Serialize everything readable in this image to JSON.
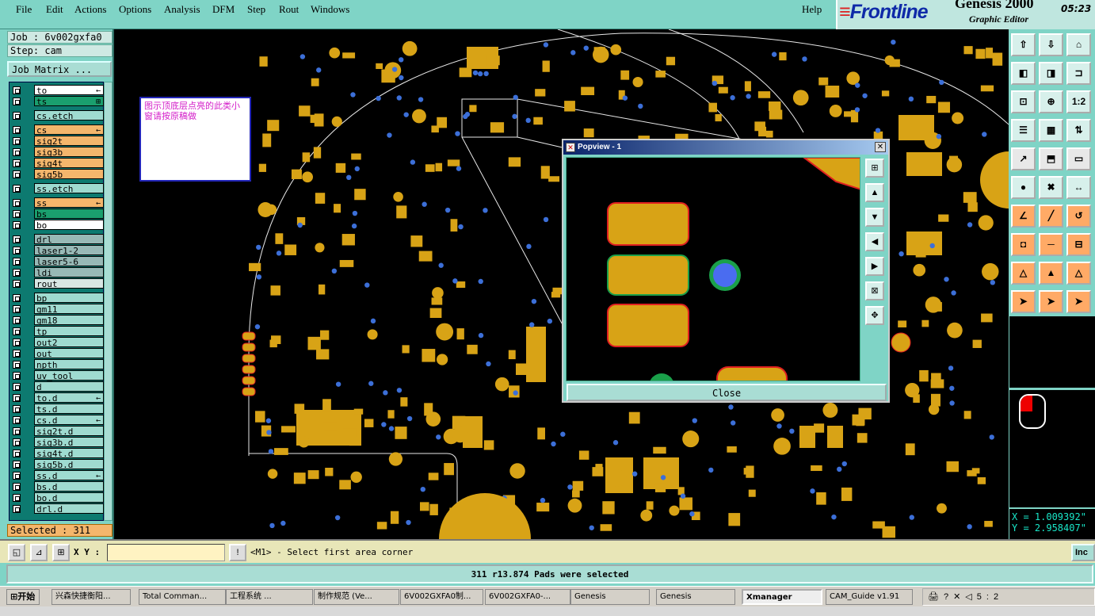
{
  "menubar": {
    "items": [
      "File",
      "Edit",
      "Actions",
      "Options",
      "Analysis",
      "DFM",
      "Step",
      "Rout",
      "Windows"
    ],
    "help": "Help"
  },
  "brand": {
    "logo": "Frontline",
    "product": "Genesis 2000",
    "subtitle": "Graphic Editor",
    "clock": "05:23"
  },
  "left_panel": {
    "job": "Job : 6v002gxfa0",
    "step": "Step: cam",
    "job_matrix": "Job Matrix ...",
    "selected": "Selected : 311",
    "layers": [
      {
        "name": "to",
        "color": "white",
        "mark": "←"
      },
      {
        "name": "ts",
        "color": "green",
        "mark": "⊞"
      },
      {
        "name": "cs.etch",
        "color": "teal"
      },
      {
        "name": "cs",
        "color": "orange",
        "mark": "←"
      },
      {
        "name": "sig2t",
        "color": "orange"
      },
      {
        "name": "sig3b",
        "color": "orange"
      },
      {
        "name": "sig4t",
        "color": "orange"
      },
      {
        "name": "sig5b",
        "color": "orange"
      },
      {
        "name": "ss.etch",
        "color": "teal"
      },
      {
        "name": "ss",
        "color": "orange",
        "mark": "←"
      },
      {
        "name": "bs",
        "color": "green"
      },
      {
        "name": "bo",
        "color": "white"
      },
      {
        "name": "drl",
        "color": "grey"
      },
      {
        "name": "laser1-2",
        "color": "grey"
      },
      {
        "name": "laser5-6",
        "color": "grey"
      },
      {
        "name": "ldi",
        "color": "grey"
      },
      {
        "name": "rout",
        "color": "light"
      },
      {
        "name": "bp",
        "color": "teal"
      },
      {
        "name": "gm11",
        "color": "teal"
      },
      {
        "name": "gm18",
        "color": "teal"
      },
      {
        "name": "tp",
        "color": "teal"
      },
      {
        "name": "out2",
        "color": "teal"
      },
      {
        "name": "out",
        "color": "teal"
      },
      {
        "name": "npth",
        "color": "teal"
      },
      {
        "name": "uv_tool",
        "color": "teal"
      },
      {
        "name": "d",
        "color": "teal"
      },
      {
        "name": "to.d",
        "color": "teal",
        "mark": "←"
      },
      {
        "name": "ts.d",
        "color": "teal"
      },
      {
        "name": "cs.d",
        "color": "teal",
        "mark": "←"
      },
      {
        "name": "sig2t.d",
        "color": "teal"
      },
      {
        "name": "sig3b.d",
        "color": "teal"
      },
      {
        "name": "sig4t.d",
        "color": "teal"
      },
      {
        "name": "sig5b.d",
        "color": "teal"
      },
      {
        "name": "ss.d",
        "color": "teal",
        "mark": "←"
      },
      {
        "name": "bs.d",
        "color": "teal"
      },
      {
        "name": "bo.d",
        "color": "teal"
      },
      {
        "name": "drl.d",
        "color": "teal"
      }
    ]
  },
  "canvas": {
    "note": "图示顶底层点亮的此类小窗请按原稿做",
    "colors": {
      "pad": "#d8a316",
      "via": "#3c6fd8",
      "outline": "#e8e8e8",
      "pad_edge": "#e02020"
    }
  },
  "popview": {
    "title": "Popview - 1",
    "close_label": "Close"
  },
  "right_toolbar": {
    "coord_x": "X = 1.009392\"",
    "coord_y": "Y = 2.958407\""
  },
  "command_bar": {
    "xy_label": "X Y :",
    "xy_value": "",
    "prompt": "<M1> - Select first area corner",
    "inc_label": "Inc"
  },
  "status": "311 r13.874 Pads were selected",
  "taskbar": {
    "start": "开始",
    "tasks": [
      "兴森快捷衡阳...",
      "Total Comman...",
      "工程系统   ...",
      "制作规范 (Ve...",
      "6V002GXFA0制...",
      "6V002GXFA0-...",
      "Genesis",
      "Genesis",
      "Xmanager",
      "CAM_Guide v1.91"
    ],
    "active_index": 8,
    "tray_time": "5:2"
  }
}
